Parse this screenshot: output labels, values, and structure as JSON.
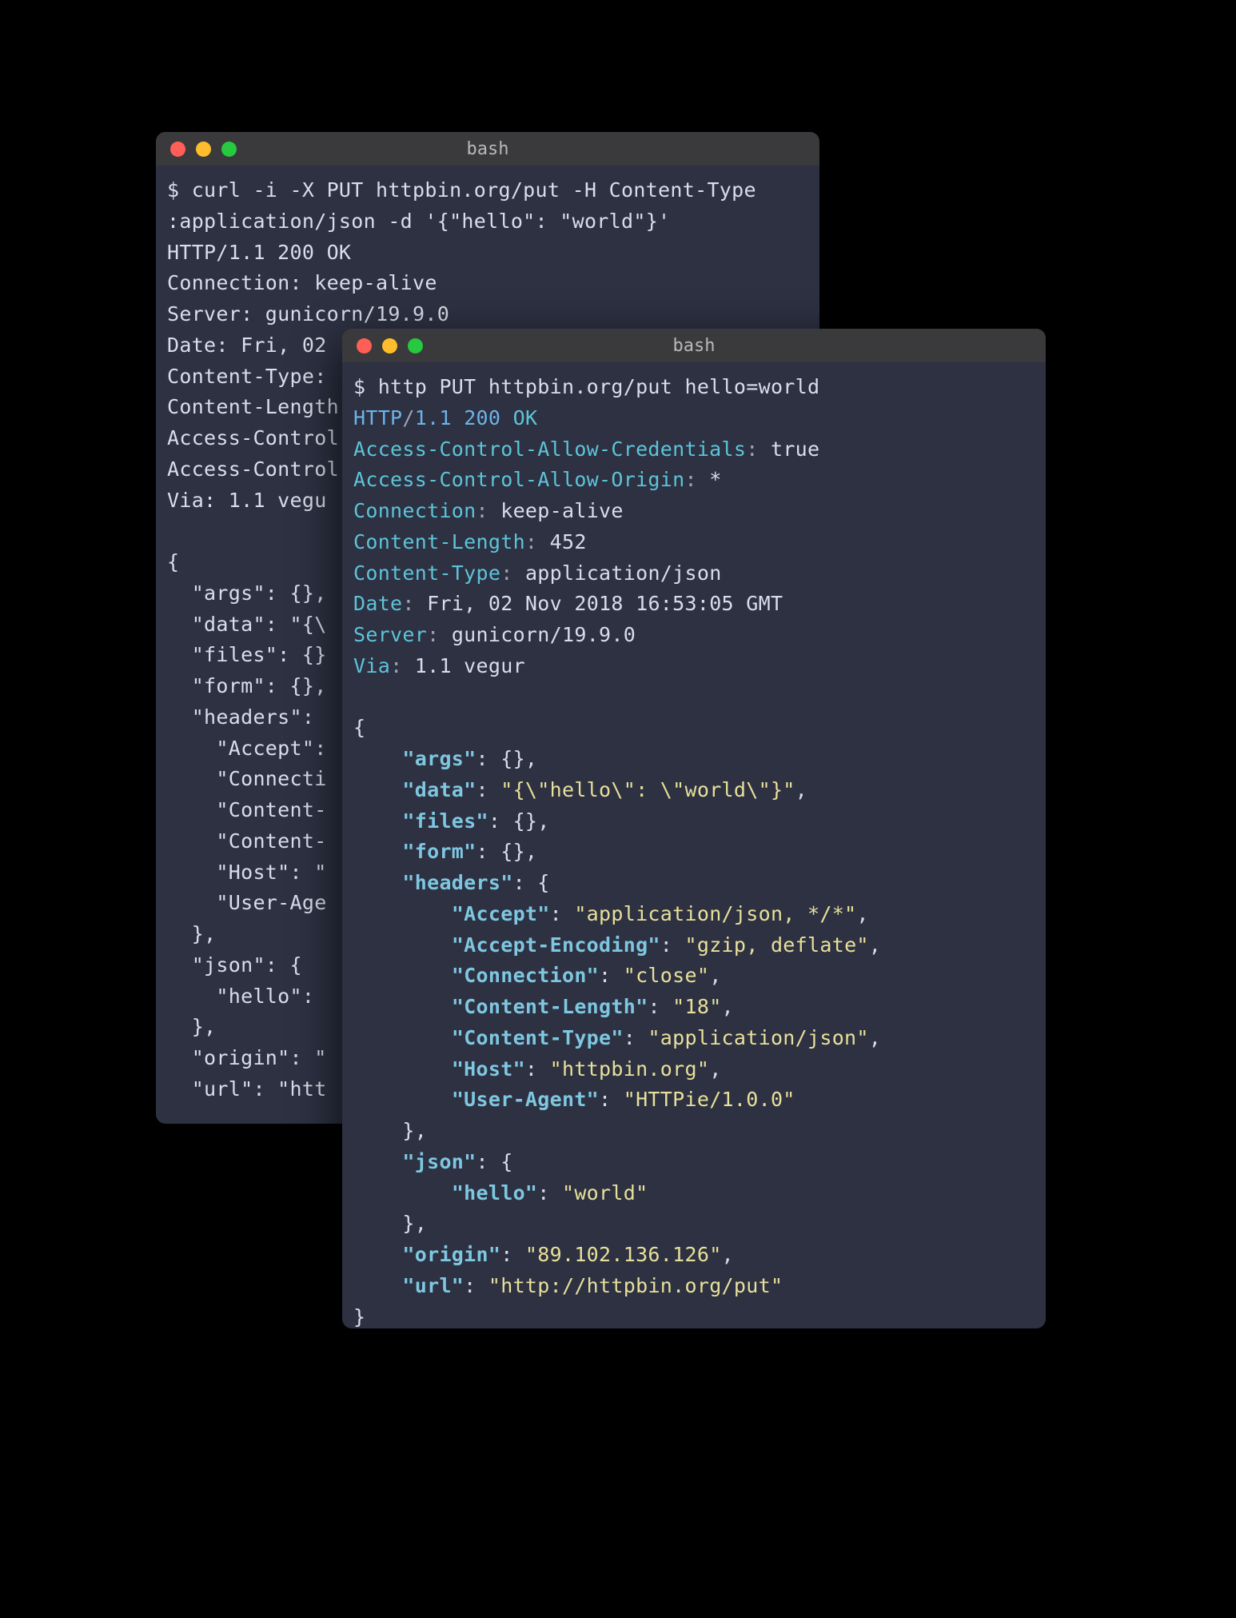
{
  "back": {
    "title": "bash",
    "lines": {
      "l1": "$ curl -i -X PUT httpbin.org/put -H Content-Type",
      "l2": ":application/json -d '{\"hello\": \"world\"}'",
      "l3": "HTTP/1.1 200 OK",
      "l4": "Connection: keep-alive",
      "l5": "Server: gunicorn/19.9.0",
      "l6": "Date: Fri, 02 ",
      "l7": "Content-Type: ",
      "l8": "Content-Length",
      "l9": "Access-Control",
      "l10": "Access-Control",
      "l11": "Via: 1.1 vegu",
      "l12": "",
      "l13": "{",
      "l14": "  \"args\": {},",
      "l15": "  \"data\": \"{\\",
      "l16": "  \"files\": {}",
      "l17": "  \"form\": {},",
      "l18": "  \"headers\": ",
      "l19": "    \"Accept\":",
      "l20": "    \"Connecti",
      "l21": "    \"Content-",
      "l22": "    \"Content-",
      "l23": "    \"Host\": \"",
      "l24": "    \"User-Age",
      "l25": "  },",
      "l26": "  \"json\": {",
      "l27": "    \"hello\": ",
      "l28": "  },",
      "l29": "  \"origin\": \"",
      "l30": "  \"url\": \"htt"
    }
  },
  "front": {
    "title": "bash",
    "cmd": "$ http PUT httpbin.org/put hello=world",
    "status": {
      "proto": "HTTP",
      "slash": "/",
      "ver": "1.1",
      "code": "200",
      "msg": "OK"
    },
    "headers": {
      "h1k": "Access-Control-Allow-Credentials",
      "h1v": "true",
      "h2k": "Access-Control-Allow-Origin",
      "h2v": "*",
      "h3k": "Connection",
      "h3v": "keep-alive",
      "h4k": "Content-Length",
      "h4v": "452",
      "h5k": "Content-Type",
      "h5v": "application/json",
      "h6k": "Date",
      "h6v": "Fri, 02 Nov 2018 16:53:05 GMT",
      "h7k": "Server",
      "h7v": "gunicorn/19.9.0",
      "h8k": "Via",
      "h8v": "1.1 vegur"
    },
    "json": {
      "open": "{",
      "args_k": "\"args\"",
      "args_v": "{}",
      "data_k": "\"data\"",
      "data_v": "\"{\\\"hello\\\": \\\"world\\\"}\"",
      "files_k": "\"files\"",
      "files_v": "{}",
      "form_k": "\"form\"",
      "form_v": "{}",
      "headers_k": "\"headers\"",
      "accept_k": "\"Accept\"",
      "accept_v": "\"application/json, */*\"",
      "ae_k": "\"Accept-Encoding\"",
      "ae_v": "\"gzip, deflate\"",
      "conn_k": "\"Connection\"",
      "conn_v": "\"close\"",
      "cl_k": "\"Content-Length\"",
      "cl_v": "\"18\"",
      "ct_k": "\"Content-Type\"",
      "ct_v": "\"application/json\"",
      "host_k": "\"Host\"",
      "host_v": "\"httpbin.org\"",
      "ua_k": "\"User-Agent\"",
      "ua_v": "\"HTTPie/1.0.0\"",
      "json_k": "\"json\"",
      "hello_k": "\"hello\"",
      "hello_v": "\"world\"",
      "origin_k": "\"origin\"",
      "origin_v": "\"89.102.136.126\"",
      "url_k": "\"url\"",
      "url_v": "\"http://httpbin.org/put\"",
      "close": "}"
    }
  }
}
